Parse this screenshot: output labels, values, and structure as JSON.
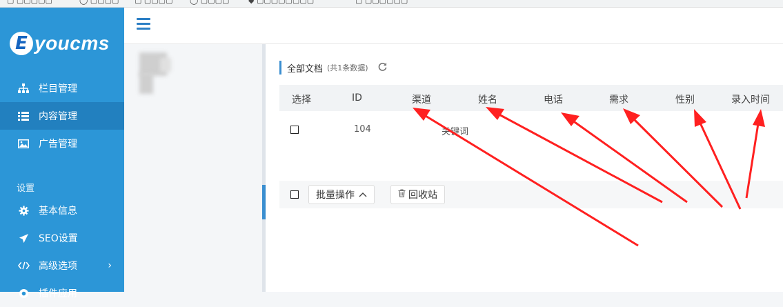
{
  "sidebar": {
    "logo_letter": "E",
    "logo_text": "youcms",
    "items": [
      {
        "label": "栏目管理",
        "icon": "sitemap-icon"
      },
      {
        "label": "内容管理",
        "icon": "list-icon"
      },
      {
        "label": "广告管理",
        "icon": "image-icon"
      }
    ],
    "section_label": "设置",
    "settings_items": [
      {
        "label": "基本信息",
        "icon": "gear-icon"
      },
      {
        "label": "SEO设置",
        "icon": "paper-plane-icon"
      },
      {
        "label": "高级选项",
        "icon": "code-icon"
      },
      {
        "label": "插件应用",
        "icon": "plugin-icon"
      }
    ]
  },
  "content": {
    "title": "全部文档",
    "count": "(共1条数据)",
    "columns": [
      "选择",
      "ID",
      "渠道",
      "姓名",
      "电话",
      "需求",
      "性别",
      "录入时间"
    ],
    "rows": [
      {
        "id": "104",
        "keyword": "关键词"
      }
    ],
    "batch_button": "批量操作",
    "recycle_button": "回收站"
  },
  "colors": {
    "sidebar_bg": "#2c96d7",
    "sidebar_active": "#2280bf",
    "accent": "#3a8ed0",
    "arrow": "#ff2020"
  }
}
